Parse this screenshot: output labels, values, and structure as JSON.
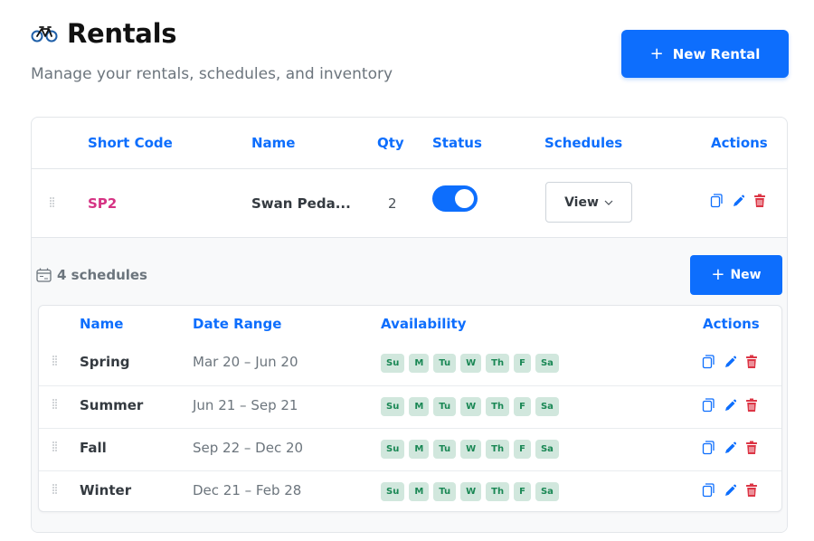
{
  "header": {
    "title": "Rentals",
    "subtitle": "Manage your rentals, schedules, and inventory",
    "icon": "bicycle-icon"
  },
  "new_rental_button": {
    "label": "New Rental",
    "icon": "plus-icon"
  },
  "table": {
    "columns": {
      "short_code": "Short Code",
      "name": "Name",
      "qty": "Qty",
      "status": "Status",
      "schedules": "Schedules",
      "actions": "Actions"
    },
    "rows": [
      {
        "short_code": "SP2",
        "name": "Swan Peda...",
        "qty": "2",
        "status_enabled": true,
        "schedules_select": "View"
      }
    ]
  },
  "schedules_panel": {
    "count_label": "4 schedules",
    "new_button": "New",
    "columns": {
      "name": "Name",
      "date_range": "Date Range",
      "availability": "Availability",
      "actions": "Actions"
    },
    "day_labels": [
      "Su",
      "M",
      "Tu",
      "W",
      "Th",
      "F",
      "Sa"
    ],
    "rows": [
      {
        "name": "Spring",
        "date_range": "Mar 20 – Jun 20"
      },
      {
        "name": "Summer",
        "date_range": "Jun 21 – Sep 21"
      },
      {
        "name": "Fall",
        "date_range": "Sep 22 – Dec 20"
      },
      {
        "name": "Winter",
        "date_range": "Dec 21 – Feb 28"
      }
    ]
  },
  "colors": {
    "primary": "#0d6efd",
    "code": "#d63384",
    "delete": "#dc3545",
    "day_badge_bg": "#d1e7dd",
    "day_badge_text": "#198754"
  }
}
